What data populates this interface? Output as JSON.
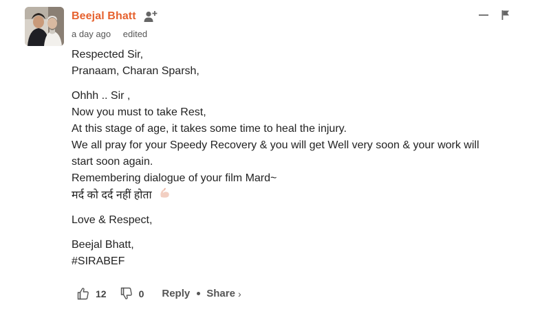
{
  "comment": {
    "author": "Beejal Bhatt",
    "timestamp": "a day ago",
    "edited_label": "edited",
    "body_lines": {
      "l1": "Respected Sir,",
      "l2": "Pranaam, Charan Sparsh,",
      "l3": "Ohhh .. Sir ,",
      "l4": "Now you must to take Rest,",
      "l5": "At this stage of age, it takes some time to heal the injury.",
      "l6": "We all pray for your Speedy Recovery & you will get Well very soon & your work will",
      "l7": "start soon again.",
      "l8": "Remembering dialogue of your film Mard~",
      "l9": "मर्द को दर्द नहीं होता",
      "l10": "Love & Respect,",
      "l11": "Beejal Bhatt,",
      "l12": "#SIRABEF"
    },
    "likes": "12",
    "dislikes": "0",
    "reply_label": "Reply",
    "share_label": "Share",
    "share_chevron": "›"
  },
  "icons": {
    "follow": "add-user-icon",
    "collapse": "minus-icon",
    "flag": "flag-icon",
    "like": "thumbs-up-icon",
    "dislike": "thumbs-down-icon",
    "emoji": "flexed-biceps-emoji"
  },
  "colors": {
    "author": "#e6622f",
    "text": "#222222",
    "meta": "#555555"
  }
}
